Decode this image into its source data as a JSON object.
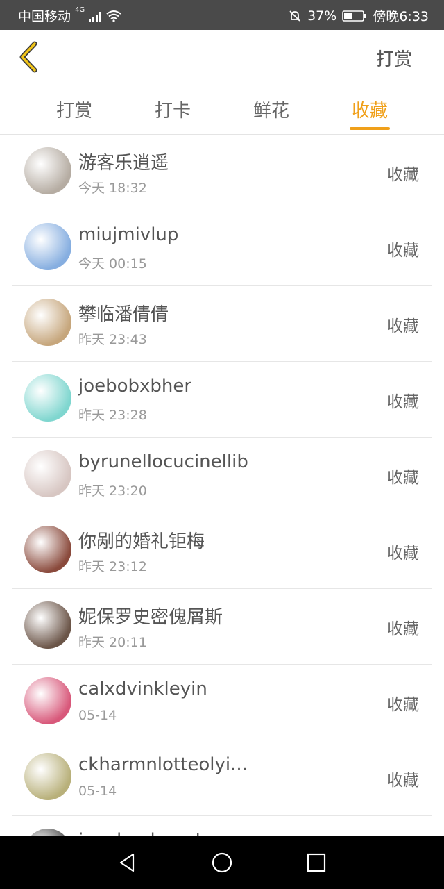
{
  "status_bar": {
    "carrier": "中国移动",
    "network": "4G",
    "battery": "37%",
    "time": "傍晚6:33"
  },
  "header": {
    "action_label": "打赏"
  },
  "tabs": [
    {
      "label": "打赏",
      "active": false
    },
    {
      "label": "打卡",
      "active": false
    },
    {
      "label": "鲜花",
      "active": false
    },
    {
      "label": "收藏",
      "active": true
    }
  ],
  "accent_color": "#f0a01a",
  "list": [
    {
      "name": "游客乐逍遥",
      "time": "今天 18:32",
      "action": "收藏",
      "avatar_color": "#b5aca2"
    },
    {
      "name": "miujmivlup",
      "time": "今天 00:15",
      "action": "收藏",
      "avatar_color": "#86aee0"
    },
    {
      "name": "攀临潘倩倩",
      "time": "昨天 23:43",
      "action": "收藏",
      "avatar_color": "#c6a67c"
    },
    {
      "name": "joebobxbher",
      "time": "昨天 23:28",
      "action": "收藏",
      "avatar_color": "#7fd6cf"
    },
    {
      "name": "byrunellocucinellib",
      "time": "昨天 23:20",
      "action": "收藏",
      "avatar_color": "#d7c6c2"
    },
    {
      "name": "你剐的婚礼钜梅",
      "time": "昨天 23:12",
      "action": "收藏",
      "avatar_color": "#8a4a3c"
    },
    {
      "name": "妮保罗史密傀屑斯",
      "time": "昨天 20:11",
      "action": "收藏",
      "avatar_color": "#6b5548"
    },
    {
      "name": "calxdvinkleyin",
      "time": "05-14",
      "action": "收藏",
      "avatar_color": "#d8587a"
    },
    {
      "name": "ckharmnlotteolyi...",
      "time": "05-14",
      "action": "收藏",
      "avatar_color": "#b8b07a"
    },
    {
      "name": "iyuebnylervatee",
      "time": "",
      "action": "",
      "avatar_color": "#444444"
    }
  ]
}
